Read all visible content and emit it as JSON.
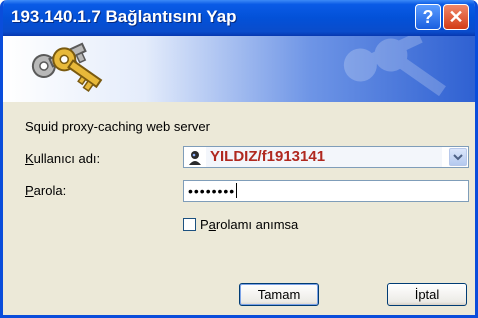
{
  "window": {
    "title": "193.140.1.7 Bağlantısını Yap",
    "help_label": "?",
    "close_label": "✕"
  },
  "dialog": {
    "message": "Squid proxy-caching web server",
    "username_label_mnemonic": "K",
    "username_label_rest": "ullanıcı adı:",
    "username_value": "YILDIZ/f1913141",
    "password_label_mnemonic": "P",
    "password_label_rest": "arola:",
    "password_value": "••••••••",
    "remember_label_prefix": "P",
    "remember_label_mnemonic": "a",
    "remember_label_rest": "rolamı anımsa",
    "remember_checked": false,
    "ok_label": "Tamam",
    "cancel_label": "İptal"
  },
  "colors": {
    "titlebar": "#0351d8",
    "username_text": "#b0281f",
    "dialog_bg": "#ece9d8"
  },
  "icons": {
    "banner": "keys-icon",
    "user": "user-icon",
    "dropdown": "chevron-down-icon"
  }
}
